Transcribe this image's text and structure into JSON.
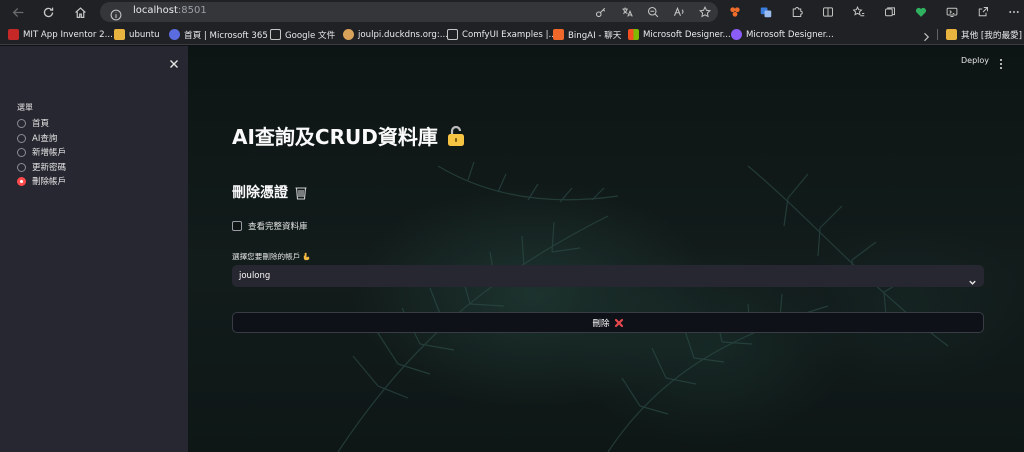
{
  "browser": {
    "address": {
      "host": "localhost",
      "port": ":8501"
    },
    "bookmarks": [
      {
        "label": "MIT App Inventor 2...",
        "icon": "mit-app-inventor-icon",
        "color": "#c62828"
      },
      {
        "label": "ubuntu",
        "icon": "folder-icon",
        "color": "#e8b33e"
      },
      {
        "label": "首頁 | Microsoft 365",
        "icon": "microsoft-365-icon",
        "color": "#5b6be0"
      },
      {
        "label": "Google 文件",
        "icon": "page-icon",
        "color": "#c4c7c5"
      },
      {
        "label": "joulpi.duckdns.org:...",
        "icon": "duckdns-icon",
        "color": "#d9a25a"
      },
      {
        "label": "ComfyUI Examples |...",
        "icon": "page-icon",
        "color": "#c4c7c5"
      },
      {
        "label": "BingAI - 聊天",
        "icon": "bingai-icon",
        "color": "#f2682a"
      },
      {
        "label": "Microsoft Designer...",
        "icon": "microsoft-logo-icon",
        "color": "#f25022"
      },
      {
        "label": "Microsoft Designer...",
        "icon": "designer-icon",
        "color": "#8b5cf6"
      }
    ],
    "other_bookmarks": "其他 [我的最愛]"
  },
  "sidebar": {
    "label": "選單",
    "options": [
      {
        "label": "首頁",
        "selected": false
      },
      {
        "label": "AI查詢",
        "selected": false
      },
      {
        "label": "新增帳戶",
        "selected": false
      },
      {
        "label": "更新密碼",
        "selected": false
      },
      {
        "label": "刪除帳戶",
        "selected": true
      }
    ]
  },
  "header": {
    "deploy_label": "Deploy"
  },
  "main": {
    "title": "AI查詢及CRUD資料庫",
    "subtitle": "刪除憑證",
    "checkbox_label": "查看完整資料庫",
    "select_label": "選擇您要刪除的帳戶",
    "select_value": "joulong",
    "delete_label": "刪除"
  },
  "colors": {
    "accent": "#ff4b4b",
    "sidebar_bg": "#262730",
    "main_bg": "#0e1117"
  }
}
